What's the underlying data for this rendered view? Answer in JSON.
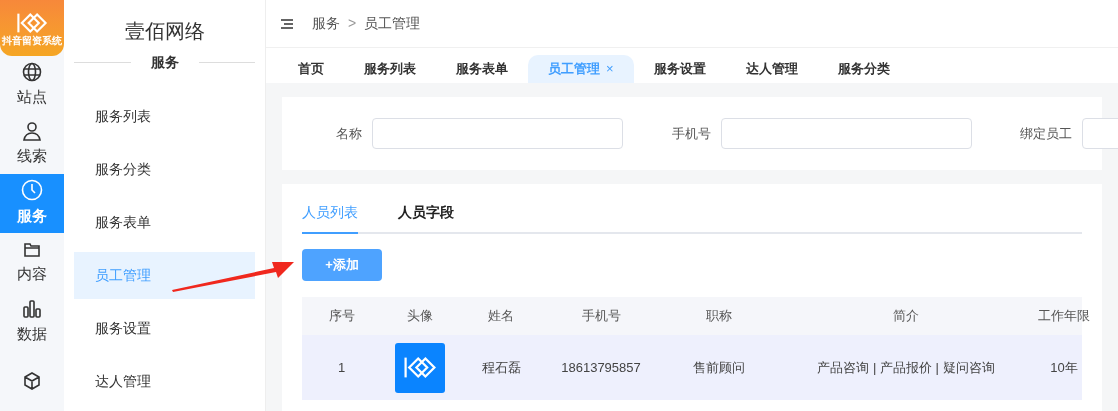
{
  "logo": {
    "caption": "抖音留资系统"
  },
  "rail": [
    {
      "label": "站点",
      "kind": "globe",
      "selected": false
    },
    {
      "label": "线索",
      "kind": "user",
      "selected": false
    },
    {
      "label": "服务",
      "kind": "clock",
      "selected": true
    },
    {
      "label": "内容",
      "kind": "folder",
      "selected": false
    },
    {
      "label": "数据",
      "kind": "bars",
      "selected": false
    },
    {
      "kind": "box",
      "selected": false
    }
  ],
  "sidebar": {
    "title": "壹佰网络",
    "section": "服务",
    "items": [
      {
        "label": "服务列表",
        "selected": false
      },
      {
        "label": "服务分类",
        "selected": false
      },
      {
        "label": "服务表单",
        "selected": false
      },
      {
        "label": "员工管理",
        "selected": true
      },
      {
        "label": "服务设置",
        "selected": false
      },
      {
        "label": "达人管理",
        "selected": false
      }
    ]
  },
  "breadcrumb": [
    "服务",
    ">",
    "员工管理"
  ],
  "page_tabs": [
    {
      "label": "首页",
      "selected": false
    },
    {
      "label": "服务列表",
      "selected": false
    },
    {
      "label": "服务表单",
      "selected": false
    },
    {
      "label": "员工管理",
      "selected": true,
      "close": "×"
    },
    {
      "label": "服务设置",
      "selected": false
    },
    {
      "label": "达人管理",
      "selected": false
    },
    {
      "label": "服务分类",
      "selected": false
    }
  ],
  "filters": [
    {
      "label": "名称"
    },
    {
      "label": "手机号"
    },
    {
      "label": "绑定员工"
    }
  ],
  "content_tabs": [
    {
      "label": "人员列表",
      "selected": true
    },
    {
      "label": "人员字段",
      "selected": false
    }
  ],
  "add_button": "+添加",
  "table": {
    "columns": [
      "序号",
      "头像",
      "姓名",
      "手机号",
      "职称",
      "简介",
      "工作年限"
    ],
    "rows": [
      {
        "index": "1",
        "name": "程石磊",
        "phone": "18613795857",
        "title": "售前顾问",
        "intro": "产品咨询 | 产品报价 | 疑问咨询",
        "years": "10年"
      }
    ]
  }
}
